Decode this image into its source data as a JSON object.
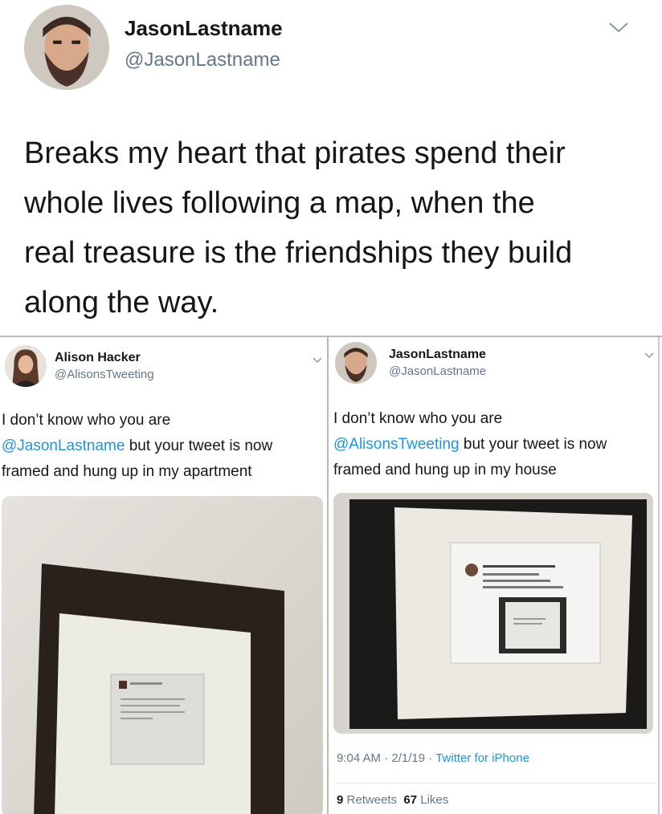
{
  "main_tweet": {
    "name": "JasonLastname",
    "handle": "@JasonLastname",
    "text_lines": [
      "Breaks my heart that pirates spend their",
      "whole lives following a map, when the",
      "real treasure is the friendships they build",
      "along the way."
    ]
  },
  "left_tweet": {
    "name": "Alison Hacker",
    "handle": "@AlisonsTweeting",
    "line1": "I don’t know who you are",
    "mention": "@JasonLastname",
    "line2_rest": " but your tweet is now",
    "line3": "framed and hung up in my apartment"
  },
  "right_tweet": {
    "name": "JasonLastname",
    "handle": "@JasonLastname",
    "line1": "I don’t know who you are",
    "mention": "@AlisonsTweeting",
    "line2_rest": " but your tweet is now",
    "line3": "framed and hung up in my house",
    "time": "9:04 AM",
    "date": "2/1/19",
    "separator": "·",
    "source": "Twitter for iPhone",
    "retweets_count": "9",
    "retweets_label": "Retweets",
    "likes_count": "67",
    "likes_label": "Likes"
  },
  "icons": {
    "menu": "chevron-down-icon"
  }
}
